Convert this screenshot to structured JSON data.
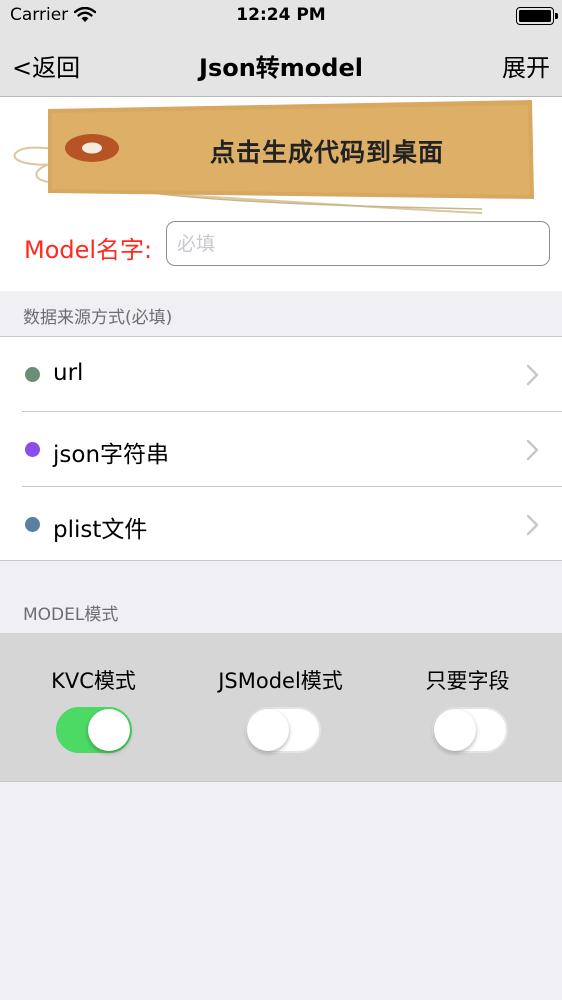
{
  "status_bar": {
    "carrier": "Carrier",
    "time": "12:24 PM"
  },
  "nav": {
    "back": "<返回",
    "title": "Json转model",
    "right": "展开"
  },
  "tag": {
    "text": "点击生成代码到桌面"
  },
  "model_name": {
    "label": "Model名字:",
    "placeholder": "必填",
    "value": ""
  },
  "data_source": {
    "header": "数据来源方式(必填)",
    "items": [
      {
        "label": "url",
        "dot_color": "#6b8f75"
      },
      {
        "label": "json字符串",
        "dot_color": "#8a4fe8"
      },
      {
        "label": "plist文件",
        "dot_color": "#5a7fa0"
      }
    ]
  },
  "model_mode": {
    "header": "MODEL模式",
    "switches": [
      {
        "label": "KVC模式",
        "on": true
      },
      {
        "label": "JSModel模式",
        "on": false
      },
      {
        "label": "只要字段",
        "on": false
      }
    ]
  },
  "colors": {
    "accent_red": "#ff2a1f",
    "switch_on": "#4cd964",
    "background": "#efeff4"
  }
}
